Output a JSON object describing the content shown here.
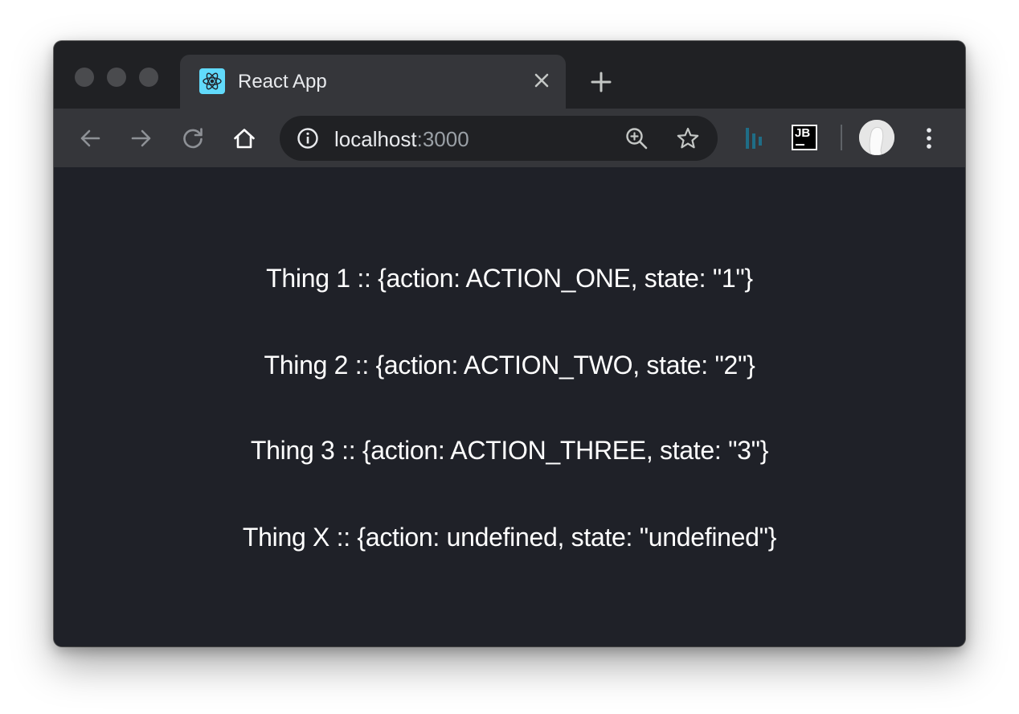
{
  "browser": {
    "tab": {
      "title": "React App",
      "favicon": "react-logo-icon"
    },
    "new_tab": "plus-icon",
    "toolbar": {
      "back": "arrow-left-icon",
      "forward": "arrow-right-icon",
      "reload": "reload-icon",
      "home": "home-icon",
      "menu": "kebab-menu-icon"
    },
    "omnibox": {
      "host": "localhost",
      "port": ":3000",
      "info": "info-icon",
      "zoom": "zoom-in-icon",
      "bookmark": "star-icon"
    },
    "extensions": [
      "stack-extension-icon",
      "jetbrains-extension-icon"
    ],
    "jetbrains_label": "JB",
    "colors": {
      "titlebar": "#202124",
      "toolbar": "#35363a",
      "omnibox": "#202124",
      "page_background": "#1f2128",
      "react_blue": "#61dafb"
    }
  },
  "page": {
    "lines": [
      "Thing 1 :: {action: ACTION_ONE, state: \"1\"}",
      "Thing 2 :: {action: ACTION_TWO, state: \"2\"}",
      "Thing 3 :: {action: ACTION_THREE, state: \"3\"}",
      "Thing X :: {action: undefined, state: \"undefined\"}"
    ]
  }
}
